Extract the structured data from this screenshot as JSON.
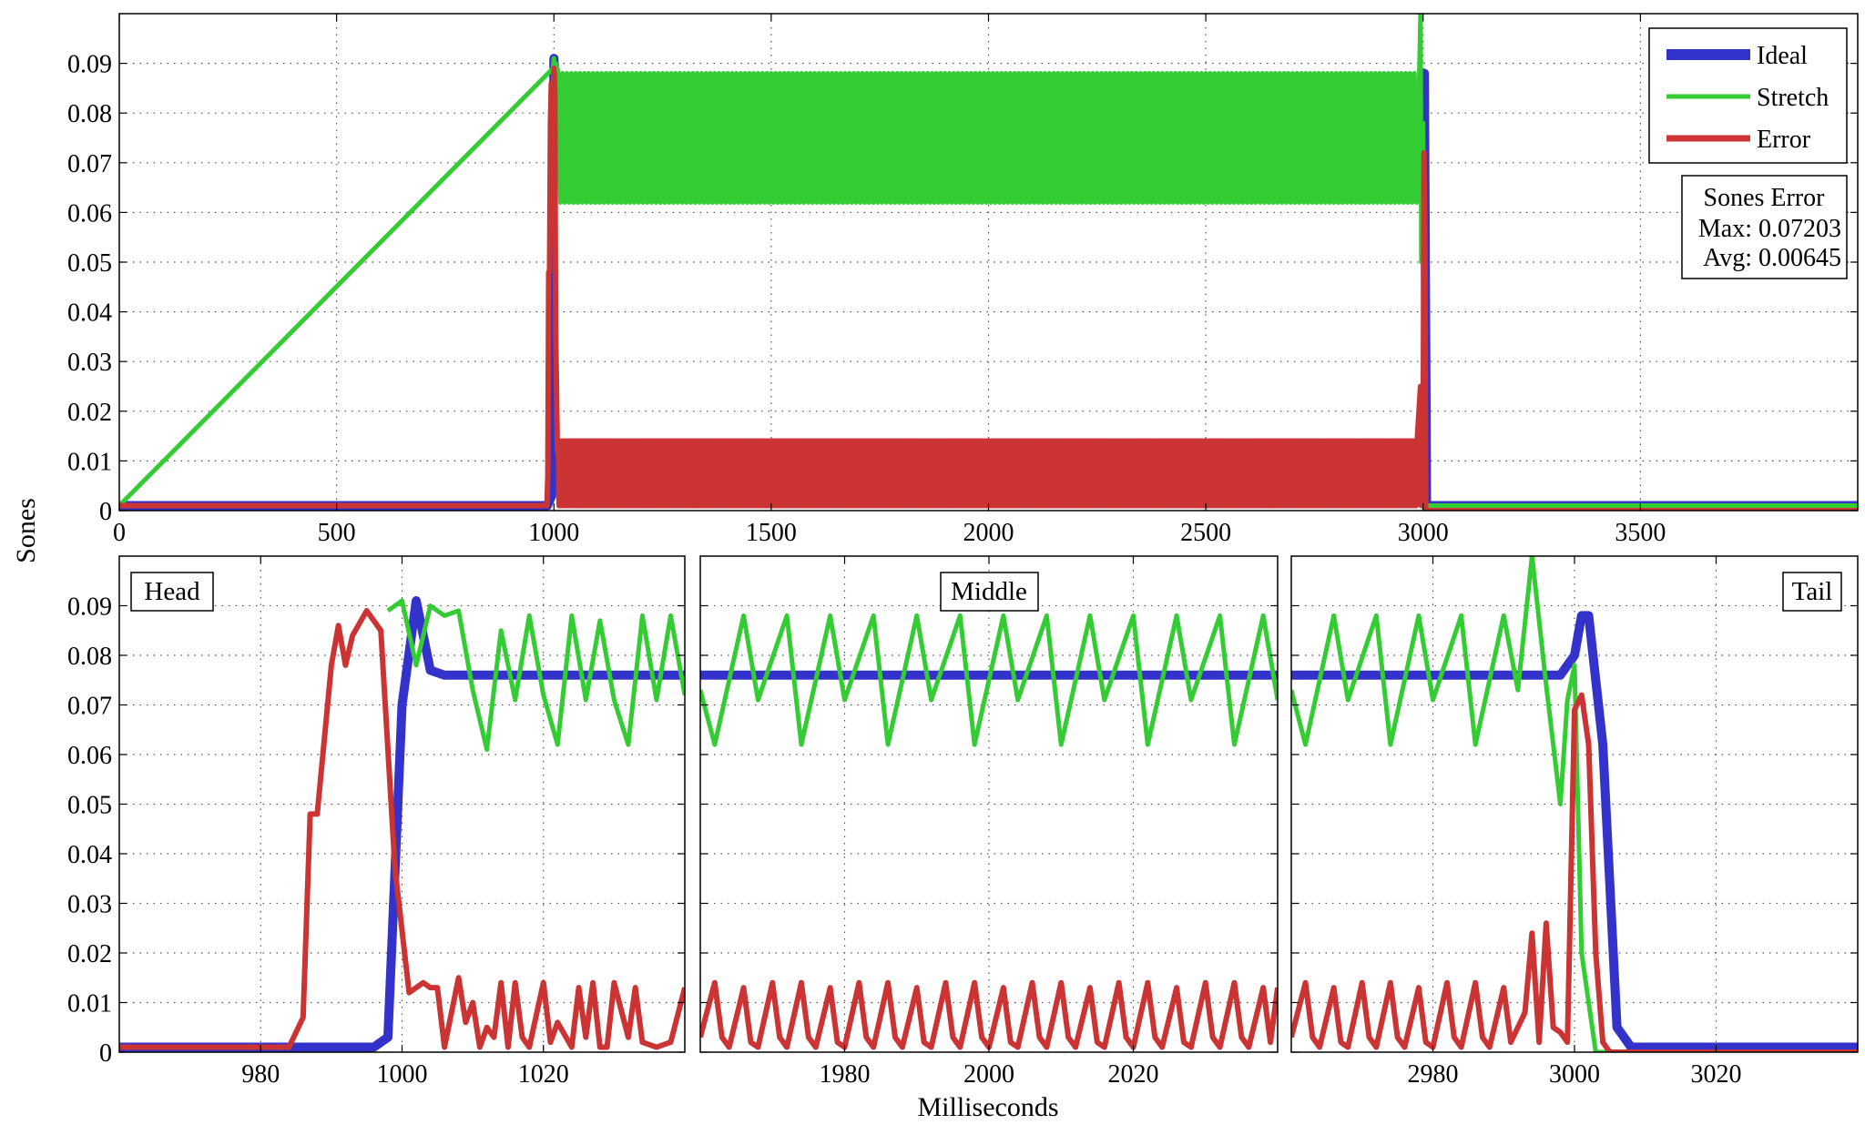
{
  "figure": {
    "ylabel": "Sones",
    "xlabel": "Milliseconds",
    "colors": {
      "ideal": "#3333cc",
      "stretch": "#33cc33",
      "error": "#cc3333",
      "grid": "#555555"
    }
  },
  "legend": {
    "entries": [
      {
        "label": "Ideal",
        "color": "#3333cc"
      },
      {
        "label": "Stretch",
        "color": "#33cc33"
      },
      {
        "label": "Error",
        "color": "#cc3333"
      }
    ],
    "placement": "top-right"
  },
  "stats": {
    "title": "Sones Error",
    "max_line": "Max: 0.07203",
    "avg_line": "Avg: 0.00645"
  },
  "chart_data": [
    {
      "id": "overview",
      "type": "line",
      "xlim": [
        0,
        4000
      ],
      "ylim": [
        0,
        0.1
      ],
      "xticks": [
        0,
        500,
        1000,
        1500,
        2000,
        2500,
        3000,
        3500
      ],
      "yticks": [
        0,
        0.01,
        0.02,
        0.03,
        0.04,
        0.05,
        0.06,
        0.07,
        0.08,
        0.09
      ],
      "ytick_labels": [
        "0",
        "0.01",
        "0.02",
        "0.03",
        "0.04",
        "0.05",
        "0.06",
        "0.07",
        "0.08",
        "0.09"
      ],
      "grid": true,
      "series": [
        {
          "name": "Ideal",
          "x": [
            0,
            985,
            995,
            1000,
            1008,
            1010,
            2990,
            2998,
            3003,
            3008,
            4000
          ],
          "y": [
            0.001,
            0.001,
            0.003,
            0.091,
            0.077,
            0.076,
            0.076,
            0.088,
            0.088,
            0.001,
            0.001
          ]
        },
        {
          "name": "Stretch",
          "osc_x_start": 1010,
          "osc_x_end": 2985,
          "osc_period": 10,
          "osc_low": 0.062,
          "osc_high": 0.088,
          "x": [
            0,
            998,
            1000,
            1002,
            1004,
            1006,
            1008,
            2988,
            2994,
            2996,
            3000,
            3003,
            3010,
            4000
          ],
          "y": [
            0.001,
            0.089,
            0.091,
            0.078,
            0.09,
            0.088,
            0.089,
            0.073,
            0.1,
            0.05,
            0.078,
            0.0,
            0.001,
            0.001
          ]
        },
        {
          "name": "Error",
          "osc_x_start": 1010,
          "osc_x_end": 2985,
          "osc_period": 4,
          "osc_low": 0.001,
          "osc_high": 0.014,
          "x": [
            0,
            984,
            986,
            988,
            990,
            992,
            994,
            996,
            998,
            1000,
            1002,
            1004,
            1008,
            2985,
            2994,
            2996,
            3000,
            3002,
            3004,
            3006,
            4000
          ],
          "y": [
            0.001,
            0.001,
            0.007,
            0.048,
            0.048,
            0.078,
            0.086,
            0.078,
            0.084,
            0.089,
            0.085,
            0.037,
            0.012,
            0.012,
            0.025,
            0.001,
            0.01,
            0.072,
            0.055,
            0.0,
            0.0
          ]
        }
      ]
    },
    {
      "id": "head",
      "type": "line",
      "label": "Head",
      "xlim": [
        960,
        1040
      ],
      "ylim": [
        0,
        0.1
      ],
      "xticks": [
        980,
        1000,
        1020
      ],
      "yticks": [
        0,
        0.01,
        0.02,
        0.03,
        0.04,
        0.05,
        0.06,
        0.07,
        0.08,
        0.09
      ],
      "ytick_labels": [
        "0",
        "0.01",
        "0.02",
        "0.03",
        "0.04",
        "0.05",
        "0.06",
        "0.07",
        "0.08",
        "0.09"
      ],
      "grid": true,
      "series": [
        {
          "name": "Ideal",
          "x": [
            960,
            996,
            998,
            1000,
            1002,
            1004,
            1006,
            1040
          ],
          "y": [
            0.001,
            0.001,
            0.003,
            0.07,
            0.091,
            0.077,
            0.076,
            0.076
          ]
        },
        {
          "name": "Stretch",
          "x": [
            998,
            1000,
            1002,
            1004,
            1006,
            1008,
            1010,
            1012,
            1014,
            1016,
            1018,
            1020,
            1022,
            1024,
            1026,
            1028,
            1030,
            1032,
            1034,
            1036,
            1038,
            1040
          ],
          "y": [
            0.089,
            0.091,
            0.078,
            0.09,
            0.088,
            0.089,
            0.073,
            0.061,
            0.085,
            0.071,
            0.088,
            0.072,
            0.062,
            0.088,
            0.071,
            0.087,
            0.071,
            0.062,
            0.088,
            0.071,
            0.088,
            0.072
          ]
        },
        {
          "name": "Error",
          "x": [
            960,
            984,
            986,
            987,
            988,
            990,
            991,
            992,
            993,
            995,
            997,
            999,
            1001,
            1003,
            1004,
            1005,
            1006,
            1008,
            1009,
            1010,
            1011,
            1012,
            1013,
            1014,
            1015,
            1016,
            1017,
            1018,
            1020,
            1021,
            1022,
            1024,
            1025,
            1026,
            1027,
            1028,
            1029,
            1030,
            1032,
            1033,
            1034,
            1036,
            1038,
            1040
          ],
          "y": [
            0.001,
            0.001,
            0.007,
            0.048,
            0.048,
            0.078,
            0.086,
            0.078,
            0.084,
            0.089,
            0.085,
            0.037,
            0.012,
            0.014,
            0.013,
            0.013,
            0.001,
            0.015,
            0.006,
            0.01,
            0.001,
            0.005,
            0.003,
            0.014,
            0.001,
            0.014,
            0.003,
            0.001,
            0.014,
            0.002,
            0.006,
            0.001,
            0.013,
            0.003,
            0.014,
            0.001,
            0.001,
            0.014,
            0.003,
            0.013,
            0.002,
            0.001,
            0.002,
            0.013
          ]
        }
      ]
    },
    {
      "id": "middle",
      "type": "line",
      "label": "Middle",
      "xlim": [
        1960,
        2040
      ],
      "ylim": [
        0,
        0.1
      ],
      "xticks": [
        1980,
        2000,
        2020
      ],
      "yticks": [
        0,
        0.01,
        0.02,
        0.03,
        0.04,
        0.05,
        0.06,
        0.07,
        0.08,
        0.09
      ],
      "grid": true,
      "series": [
        {
          "name": "Ideal",
          "x": [
            1960,
            2040
          ],
          "y": [
            0.076,
            0.076
          ]
        },
        {
          "name": "Stretch",
          "x": [
            1960,
            1962,
            1966,
            1968,
            1972,
            1974,
            1978,
            1980,
            1984,
            1986,
            1990,
            1992,
            1996,
            1998,
            2002,
            2004,
            2008,
            2010,
            2014,
            2016,
            2020,
            2022,
            2026,
            2028,
            2032,
            2034,
            2038,
            2040
          ],
          "y": [
            0.073,
            0.062,
            0.088,
            0.071,
            0.088,
            0.062,
            0.088,
            0.071,
            0.088,
            0.062,
            0.088,
            0.071,
            0.088,
            0.062,
            0.088,
            0.071,
            0.088,
            0.062,
            0.088,
            0.071,
            0.088,
            0.062,
            0.088,
            0.071,
            0.088,
            0.062,
            0.088,
            0.071
          ]
        },
        {
          "name": "Error",
          "x": [
            1960,
            1962,
            1963,
            1964,
            1966,
            1967,
            1968,
            1970,
            1971,
            1972,
            1974,
            1975,
            1976,
            1978,
            1979,
            1980,
            1982,
            1983,
            1984,
            1986,
            1987,
            1988,
            1990,
            1991,
            1992,
            1994,
            1995,
            1996,
            1998,
            1999,
            2000,
            2002,
            2003,
            2004,
            2006,
            2007,
            2008,
            2010,
            2011,
            2012,
            2014,
            2015,
            2016,
            2018,
            2019,
            2020,
            2022,
            2023,
            2024,
            2026,
            2027,
            2028,
            2030,
            2031,
            2032,
            2034,
            2035,
            2036,
            2038,
            2039,
            2040
          ],
          "y": [
            0.003,
            0.014,
            0.003,
            0.001,
            0.013,
            0.002,
            0.001,
            0.014,
            0.003,
            0.001,
            0.014,
            0.003,
            0.001,
            0.013,
            0.002,
            0.001,
            0.014,
            0.003,
            0.001,
            0.014,
            0.003,
            0.001,
            0.013,
            0.002,
            0.001,
            0.014,
            0.003,
            0.001,
            0.014,
            0.003,
            0.001,
            0.013,
            0.002,
            0.001,
            0.014,
            0.003,
            0.001,
            0.014,
            0.003,
            0.001,
            0.013,
            0.002,
            0.001,
            0.014,
            0.003,
            0.001,
            0.014,
            0.003,
            0.001,
            0.013,
            0.002,
            0.001,
            0.014,
            0.003,
            0.001,
            0.014,
            0.003,
            0.001,
            0.013,
            0.002,
            0.013
          ]
        }
      ]
    },
    {
      "id": "tail",
      "type": "line",
      "label": "Tail",
      "xlim": [
        2960,
        3040
      ],
      "ylim": [
        0,
        0.1
      ],
      "xticks": [
        2980,
        3000,
        3020
      ],
      "yticks": [
        0,
        0.01,
        0.02,
        0.03,
        0.04,
        0.05,
        0.06,
        0.07,
        0.08,
        0.09
      ],
      "grid": true,
      "series": [
        {
          "name": "Ideal",
          "x": [
            2960,
            2998,
            3000,
            3001,
            3002,
            3003,
            3004,
            3006,
            3008,
            3040
          ],
          "y": [
            0.076,
            0.076,
            0.08,
            0.088,
            0.088,
            0.075,
            0.062,
            0.005,
            0.001,
            0.001
          ]
        },
        {
          "name": "Stretch",
          "x": [
            2960,
            2962,
            2966,
            2968,
            2972,
            2974,
            2978,
            2980,
            2984,
            2986,
            2990,
            2992,
            2994,
            2996,
            2998,
            2999,
            3000,
            3001,
            3003,
            3040
          ],
          "y": [
            0.073,
            0.062,
            0.088,
            0.071,
            0.088,
            0.062,
            0.088,
            0.071,
            0.088,
            0.062,
            0.088,
            0.073,
            0.1,
            0.074,
            0.05,
            0.071,
            0.078,
            0.02,
            0.0,
            0.0
          ]
        },
        {
          "name": "Error",
          "x": [
            2960,
            2962,
            2963,
            2964,
            2966,
            2967,
            2968,
            2970,
            2971,
            2972,
            2974,
            2975,
            2976,
            2978,
            2979,
            2980,
            2982,
            2983,
            2984,
            2986,
            2987,
            2988,
            2990,
            2991,
            2993,
            2994,
            2995,
            2996,
            2997,
            2998,
            2999,
            3000,
            3001,
            3002,
            3003,
            3004,
            3005,
            3040
          ],
          "y": [
            0.003,
            0.014,
            0.003,
            0.001,
            0.013,
            0.002,
            0.001,
            0.014,
            0.003,
            0.001,
            0.014,
            0.003,
            0.001,
            0.013,
            0.002,
            0.001,
            0.014,
            0.003,
            0.001,
            0.014,
            0.003,
            0.001,
            0.013,
            0.002,
            0.008,
            0.024,
            0.002,
            0.026,
            0.005,
            0.004,
            0.002,
            0.069,
            0.072,
            0.062,
            0.02,
            0.002,
            0.0,
            0.0
          ]
        }
      ]
    }
  ]
}
